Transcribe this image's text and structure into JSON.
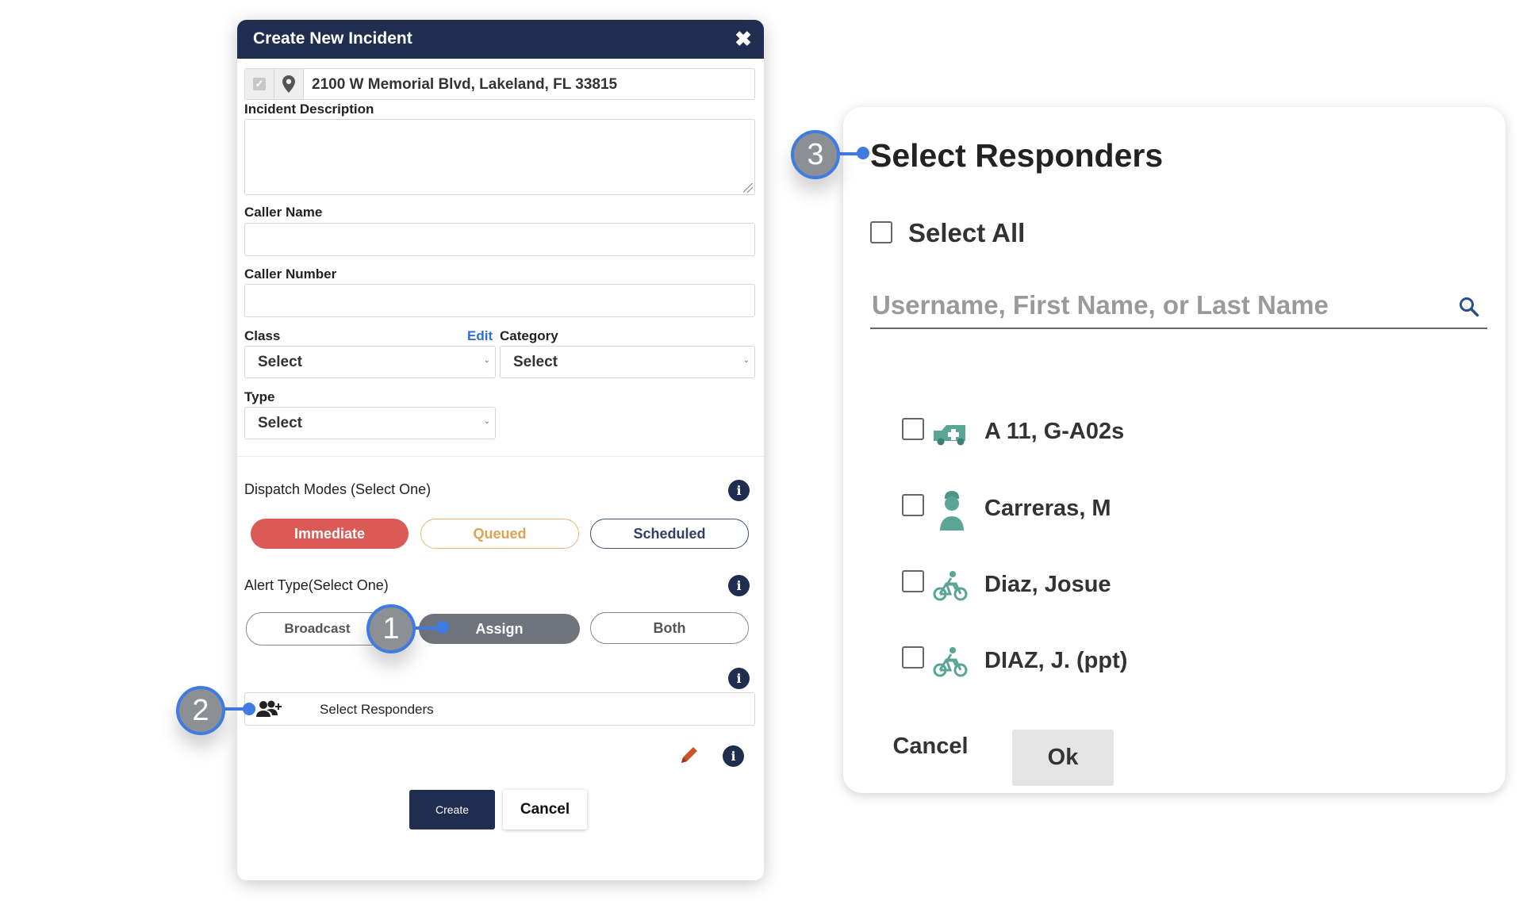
{
  "dialog": {
    "title": "Create New Incident",
    "address": "2100 W Memorial Blvd, Lakeland, FL 33815",
    "incident_description_label": "Incident Description",
    "caller_name_label": "Caller Name",
    "caller_number_label": "Caller Number",
    "class_label": "Class",
    "edit_link": "Edit",
    "category_label": "Category",
    "class_value": "Select",
    "category_value": "Select",
    "type_label": "Type",
    "type_value": "Select",
    "dispatch_modes_label": "Dispatch Modes (Select One)",
    "dispatch_modes": [
      "Immediate",
      "Queued",
      "Scheduled"
    ],
    "alert_type_label": "Alert Type(Select One)",
    "alert_types": [
      "Broadcast",
      "Assign",
      "Both"
    ],
    "select_responders_label": "Select Responders",
    "create_label": "Create",
    "cancel_label": "Cancel"
  },
  "responders_panel": {
    "title": "Select Responders",
    "select_all_label": "Select All",
    "search_placeholder": "Username, First Name, or Last Name",
    "responders": [
      {
        "name": "A 11, G-A02s",
        "icon": "ambulance-icon"
      },
      {
        "name": "Carreras, M",
        "icon": "person-icon"
      },
      {
        "name": "Diaz, Josue",
        "icon": "bicycle-icon"
      },
      {
        "name": "DIAZ, J. (ppt)",
        "icon": "bicycle-icon"
      }
    ],
    "cancel_label": "Cancel",
    "ok_label": "Ok"
  },
  "callouts": [
    "1",
    "2",
    "3"
  ],
  "colors": {
    "header_navy": "#1f2d4e",
    "immediate_red": "#dc5a55",
    "queued_orange": "#e0a055",
    "assign_gray": "#6f747c",
    "callout_blue": "#3f7be0",
    "responder_icon_teal": "#5aa596"
  }
}
